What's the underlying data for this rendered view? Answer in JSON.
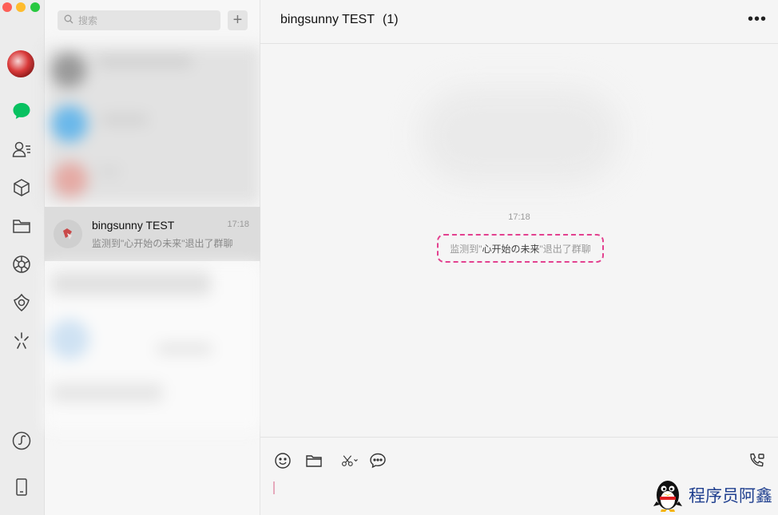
{
  "sidebar": {
    "icons": [
      "avatar",
      "chat-icon",
      "contacts-icon",
      "box-icon",
      "folder-icon",
      "moments-icon",
      "star-icon",
      "sparkle-icon",
      "mini-program-icon",
      "phone-icon"
    ],
    "active_color": "#07c160"
  },
  "search": {
    "placeholder": "搜索"
  },
  "list": {
    "add_label": "+",
    "active_session": {
      "title": "bingsunny TEST",
      "time": "17:18",
      "preview": "监测到\"心开始の未来\"退出了群聊"
    }
  },
  "conversation": {
    "title": "bingsunny TEST",
    "member_count": "(1)",
    "more_label": "•••",
    "timestamp": "17:18",
    "system_message": {
      "prefix": "监测到\"",
      "name": "心开始の未来",
      "suffix": "\"退出了群聊"
    },
    "highlight_color": "#e3418f"
  },
  "toolbar": {
    "icons": [
      "emoji-icon",
      "folder-icon",
      "scissors-icon",
      "chat-bubble-icon",
      "voice-call-icon"
    ]
  },
  "watermark": {
    "text": "程序员阿鑫"
  }
}
